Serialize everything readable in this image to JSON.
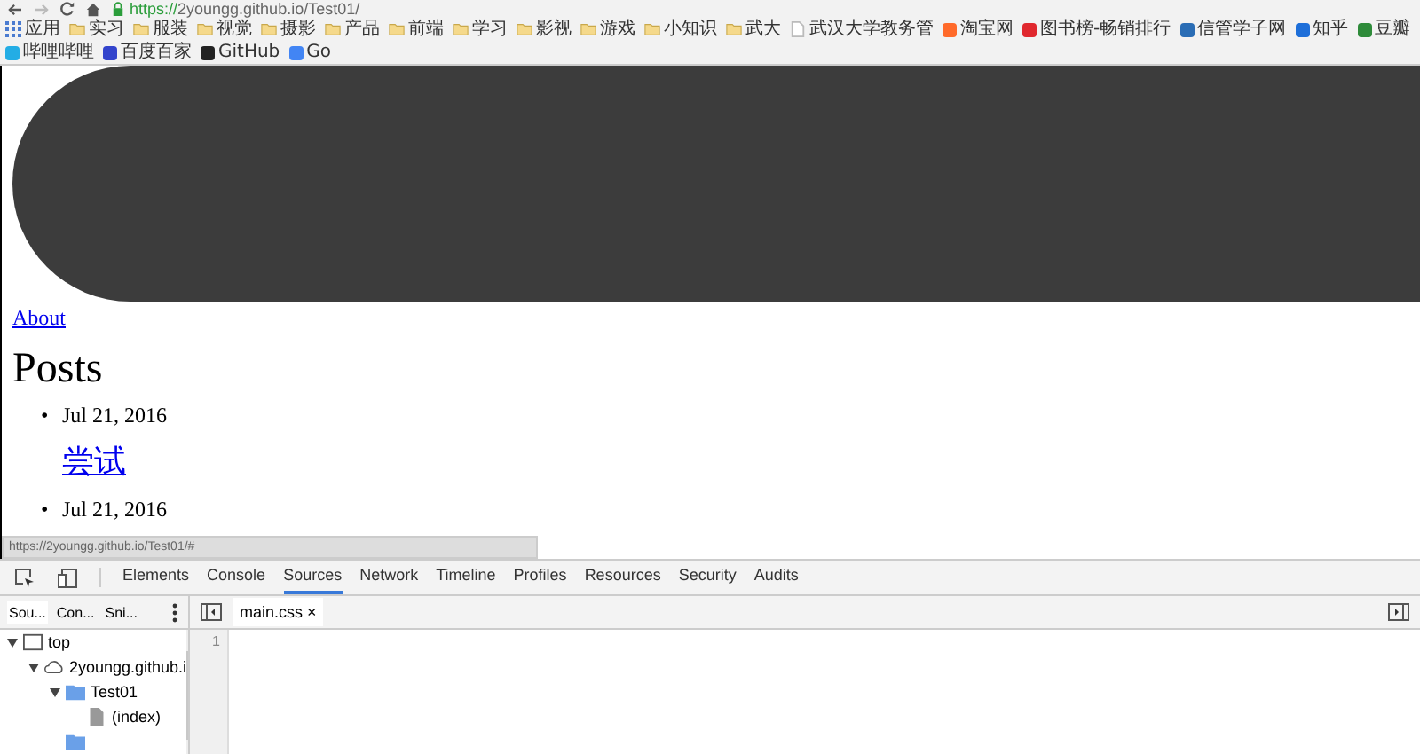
{
  "browser": {
    "url_scheme": "https://",
    "url_rest": "2youngg.github.io/Test01/"
  },
  "bookmarks": [
    {
      "kind": "apps",
      "label": "应用"
    },
    {
      "kind": "folder",
      "label": "实习"
    },
    {
      "kind": "folder",
      "label": "服装"
    },
    {
      "kind": "folder",
      "label": "视觉"
    },
    {
      "kind": "folder",
      "label": "摄影"
    },
    {
      "kind": "folder",
      "label": "产品"
    },
    {
      "kind": "folder",
      "label": "前端"
    },
    {
      "kind": "folder",
      "label": "学习"
    },
    {
      "kind": "folder",
      "label": "影视"
    },
    {
      "kind": "folder",
      "label": "游戏"
    },
    {
      "kind": "folder",
      "label": "小知识"
    },
    {
      "kind": "folder",
      "label": "武大"
    },
    {
      "kind": "page",
      "label": "武汉大学教务管"
    },
    {
      "kind": "site",
      "label": "淘宝网",
      "color": "#ff6a2a"
    },
    {
      "kind": "site",
      "label": "图书榜-畅销排行",
      "color": "#e0282e"
    },
    {
      "kind": "site",
      "label": "信管学子网",
      "color": "#2a6db5"
    },
    {
      "kind": "site",
      "label": "知乎",
      "color": "#1e6fd9"
    },
    {
      "kind": "site",
      "label": "豆瓣",
      "color": "#2e8b3a"
    },
    {
      "kind": "site",
      "label": "哔哩哔哩",
      "color": "#23ade5"
    },
    {
      "kind": "site",
      "label": "百度百家",
      "color": "#3344cc"
    },
    {
      "kind": "site",
      "label": "GitHub",
      "color": "#222222"
    },
    {
      "kind": "site",
      "label": "Go",
      "color": "#4285f4"
    }
  ],
  "page": {
    "nav_link": "About",
    "heading": "Posts",
    "posts": [
      {
        "bullet": "•",
        "date": "Jul 21, 2016",
        "title": "尝试"
      },
      {
        "bullet": "•",
        "date": "Jul 21, 2016"
      }
    ]
  },
  "status_url": "https://2youngg.github.io/Test01/#",
  "devtools": {
    "tabs": [
      {
        "label": "Elements",
        "selected": false
      },
      {
        "label": "Console",
        "selected": false
      },
      {
        "label": "Sources",
        "selected": true
      },
      {
        "label": "Network",
        "selected": false
      },
      {
        "label": "Timeline",
        "selected": false
      },
      {
        "label": "Profiles",
        "selected": false
      },
      {
        "label": "Resources",
        "selected": false
      },
      {
        "label": "Security",
        "selected": false
      },
      {
        "label": "Audits",
        "selected": false
      }
    ],
    "nav_tabs": [
      {
        "label": "Sou...",
        "selected": true
      },
      {
        "label": "Con...",
        "selected": false
      },
      {
        "label": "Sni...",
        "selected": false
      }
    ],
    "tree": [
      {
        "label": "top",
        "kind": "frame",
        "children": [
          {
            "label": "2youngg.github.i",
            "kind": "cloud",
            "children": [
              {
                "label": "Test01",
                "kind": "folder",
                "children": [
                  {
                    "label": "(index)",
                    "kind": "file"
                  }
                ]
              },
              {
                "kind": "folder"
              }
            ]
          }
        ]
      }
    ],
    "file_tab": {
      "label": "main.css",
      "close": "×"
    },
    "line_numbers": [
      "1"
    ]
  }
}
